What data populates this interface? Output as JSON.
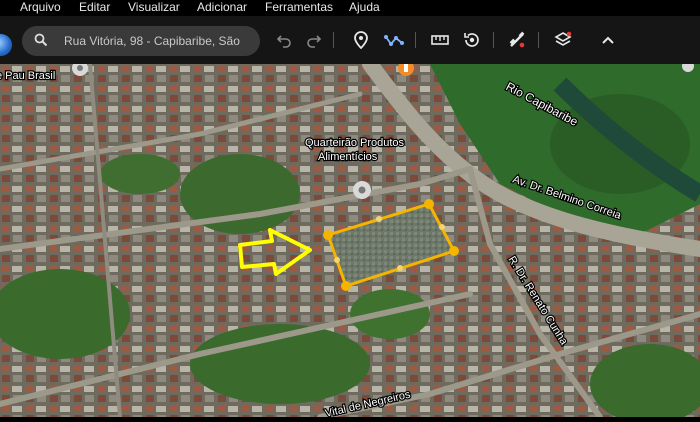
{
  "menu": [
    "Arquivo",
    "Editar",
    "Visualizar",
    "Adicionar",
    "Ferramentas",
    "Ajuda"
  ],
  "search": {
    "value": "Rua Vitória, 98 - Capibaribe, São"
  },
  "toolbar_icons": [
    "undo-icon",
    "redo-icon",
    "placemark-icon",
    "path-icon",
    "ruler-icon",
    "history-icon",
    "satellite-icon",
    "layers-icon",
    "collapse-icon"
  ],
  "map": {
    "labels": {
      "top_left": "e Pau Brasil",
      "river": "Rio Capibaribe",
      "poi_line1": "Quarteirão Produtos",
      "poi_line2": "Alimentícios",
      "avenue": "Av. Dr. Belmino Correia",
      "street_right": "R. Dr. Renato Cunha",
      "street_bottom": "Vital de Negreiros"
    },
    "colors": {
      "polygon": "#f4b400",
      "arrow": "#ffff00",
      "river_label": "#ffffff"
    }
  }
}
